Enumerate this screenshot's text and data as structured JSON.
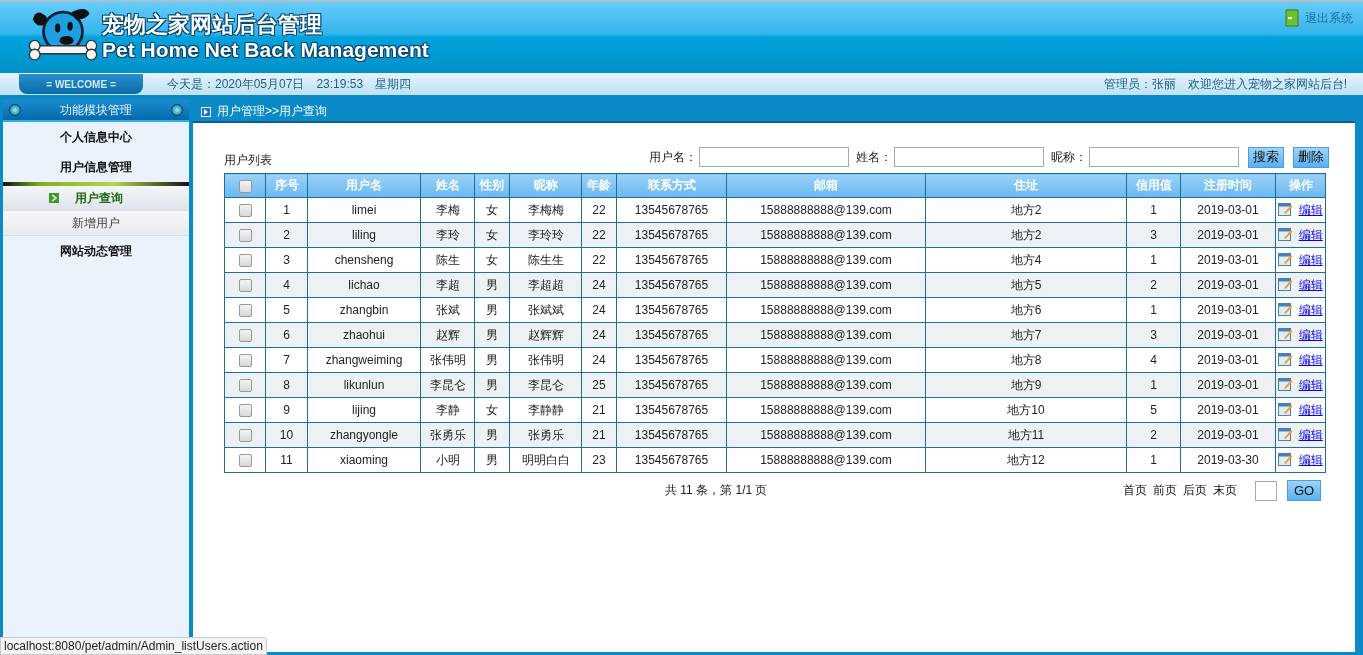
{
  "header": {
    "title_cn": "宠物之家网站后台管理",
    "title_en": "Pet Home Net Back Management",
    "logout": "退出系统"
  },
  "welcome_bar": {
    "badge": "= WELCOME =",
    "date_label": "今天是：2020年05月07日",
    "time": "23:19:53",
    "weekday": "星期四",
    "admin": "管理员：张丽",
    "greeting": "欢迎您进入宠物之家网站后台!"
  },
  "sidebar": {
    "title": "功能模块管理",
    "items": [
      {
        "label": "个人信息中心"
      },
      {
        "label": "用户信息管理",
        "children": [
          {
            "label": "用户查询",
            "selected": true
          },
          {
            "label": "新增用户",
            "selected": false
          }
        ]
      },
      {
        "label": "网站动态管理"
      }
    ]
  },
  "breadcrumb": "用户管理>>用户查询",
  "list_title": "用户列表",
  "search": {
    "fields": [
      {
        "label": "用户名："
      },
      {
        "label": "姓名："
      },
      {
        "label": "昵称："
      }
    ],
    "buttons": [
      "搜索",
      "删除"
    ]
  },
  "table": {
    "select_all_checked": false,
    "columns": [
      "序号",
      "用户名",
      "姓名",
      "性别",
      "昵称",
      "年龄",
      "联系方式",
      "邮箱",
      "住址",
      "信用值",
      "注册时间",
      "操作"
    ],
    "rows": [
      {
        "checked": false,
        "cells": [
          "1",
          "limei",
          "李梅",
          "女",
          "李梅梅",
          "22",
          "13545678765",
          "15888888888@139.com",
          "地方2",
          "1",
          "2019-03-01"
        ],
        "action": "编辑"
      },
      {
        "checked": false,
        "cells": [
          "2",
          "liling",
          "李玲",
          "女",
          "李玲玲",
          "22",
          "13545678765",
          "15888888888@139.com",
          "地方2",
          "3",
          "2019-03-01"
        ],
        "action": "编辑"
      },
      {
        "checked": false,
        "cells": [
          "3",
          "chensheng",
          "陈生",
          "女",
          "陈生生",
          "22",
          "13545678765",
          "15888888888@139.com",
          "地方4",
          "1",
          "2019-03-01"
        ],
        "action": "编辑"
      },
      {
        "checked": false,
        "cells": [
          "4",
          "lichao",
          "李超",
          "男",
          "李超超",
          "24",
          "13545678765",
          "15888888888@139.com",
          "地方5",
          "2",
          "2019-03-01"
        ],
        "action": "编辑"
      },
      {
        "checked": false,
        "cells": [
          "5",
          "zhangbin",
          "张斌",
          "男",
          "张斌斌",
          "24",
          "13545678765",
          "15888888888@139.com",
          "地方6",
          "1",
          "2019-03-01"
        ],
        "action": "编辑"
      },
      {
        "checked": false,
        "cells": [
          "6",
          "zhaohui",
          "赵辉",
          "男",
          "赵辉辉",
          "24",
          "13545678765",
          "15888888888@139.com",
          "地方7",
          "3",
          "2019-03-01"
        ],
        "action": "编辑"
      },
      {
        "checked": false,
        "cells": [
          "7",
          "zhangweiming",
          "张伟明",
          "男",
          "张伟明",
          "24",
          "13545678765",
          "15888888888@139.com",
          "地方8",
          "4",
          "2019-03-01"
        ],
        "action": "编辑"
      },
      {
        "checked": false,
        "cells": [
          "8",
          "likunlun",
          "李昆仑",
          "男",
          "李昆仑",
          "25",
          "13545678765",
          "15888888888@139.com",
          "地方9",
          "1",
          "2019-03-01"
        ],
        "action": "编辑"
      },
      {
        "checked": false,
        "cells": [
          "9",
          "lijing",
          "李静",
          "女",
          "李静静",
          "21",
          "13545678765",
          "15888888888@139.com",
          "地方10",
          "5",
          "2019-03-01"
        ],
        "action": "编辑"
      },
      {
        "checked": false,
        "cells": [
          "10",
          "zhangyongle",
          "张勇乐",
          "男",
          "张勇乐",
          "21",
          "13545678765",
          "15888888888@139.com",
          "地方11",
          "2",
          "2019-03-01"
        ],
        "action": "编辑"
      },
      {
        "checked": false,
        "cells": [
          "11",
          "xiaoming",
          "小明",
          "男",
          "明明白白",
          "23",
          "13545678765",
          "15888888888@139.com",
          "地方12",
          "1",
          "2019-03-30"
        ],
        "action": "编辑"
      }
    ]
  },
  "pagination": {
    "summary": "共 11 条，第 1/1 页",
    "links": [
      "首页",
      "前页",
      "后页",
      "末页"
    ],
    "go": "GO"
  },
  "status_url": "localhost:8080/pet/admin/Admin_listUsers.action"
}
